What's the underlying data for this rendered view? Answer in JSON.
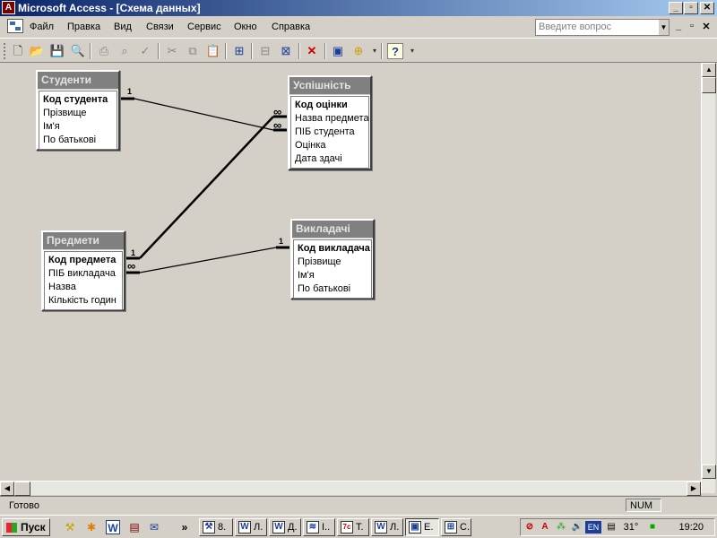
{
  "window": {
    "title": "Microsoft Access - [Схема данных]",
    "icon": "access-icon",
    "controls": [
      "_",
      "▫",
      "✕"
    ]
  },
  "menubar": {
    "items": [
      "Файл",
      "Правка",
      "Вид",
      "Связи",
      "Сервис",
      "Окно",
      "Справка"
    ],
    "ask_placeholder": "Введите вопрос",
    "doc_controls": [
      "_",
      "▫",
      "✕"
    ]
  },
  "toolbar": {
    "icons": [
      "new-icon",
      "open-icon",
      "save-icon",
      "print-preview-icon",
      "print-icon",
      "preview-icon",
      "spellcheck-icon",
      "cut-icon",
      "copy-icon",
      "paste-icon",
      "show-table-icon",
      "show-direct-icon",
      "show-all-icon",
      "delete-icon",
      "database-window-icon",
      "new-object-icon",
      "help-icon"
    ]
  },
  "tables": {
    "students": {
      "title": "Студенти",
      "fields": [
        "Код студента",
        "Прізвище",
        "Ім'я",
        "По батькові"
      ]
    },
    "grades": {
      "title": "Успішність",
      "fields": [
        "Код оцінки",
        "Назва предмета",
        "ПІБ студента",
        "Оцінка",
        "Дата здачі"
      ]
    },
    "subjects": {
      "title": "Предмети",
      "fields": [
        "Код предмета",
        "ПІБ викладача",
        "Назва",
        "Кількість годин"
      ]
    },
    "teachers": {
      "title": "Викладачі",
      "fields": [
        "Код викладача",
        "Прізвище",
        "Ім'я",
        "По батькові"
      ]
    }
  },
  "relationships": {
    "one": "1",
    "many": "∞"
  },
  "statusbar": {
    "text": "Готово",
    "num": "NUM"
  },
  "taskbar": {
    "start": "Пуск",
    "more": "»",
    "tasks": [
      {
        "icon": "⚒",
        "label": "8."
      },
      {
        "icon": "W",
        "label": "Л."
      },
      {
        "icon": "W",
        "label": "Д."
      },
      {
        "icon": "≋",
        "label": "I.."
      },
      {
        "icon": "7c",
        "label": "T."
      },
      {
        "icon": "W",
        "label": "Л."
      },
      {
        "icon": "▣",
        "label": "Е."
      },
      {
        "icon": "⊞",
        "label": "С."
      }
    ],
    "lang": "EN",
    "temp": "31°",
    "clock": "19:20"
  }
}
